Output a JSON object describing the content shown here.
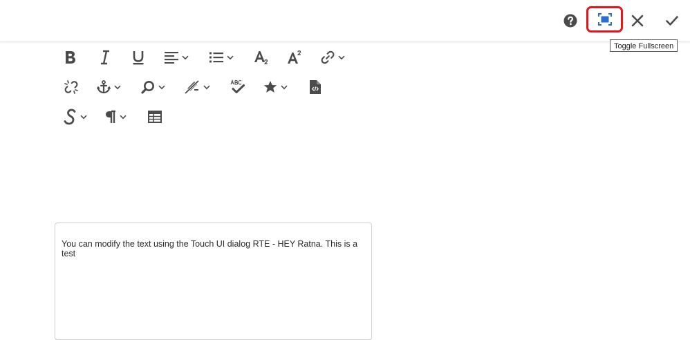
{
  "topbar": {
    "help_icon": "help-circle-icon",
    "fullscreen_icon": "fullscreen-icon",
    "close_icon": "close-icon",
    "done_icon": "checkmark-icon",
    "fullscreen_highlight_color": "#e8141c",
    "fullscreen_icon_color": "#2b6ed2",
    "icon_color": "#4b4b4b"
  },
  "tooltip": {
    "text": "Toggle Fullscreen"
  },
  "toolbar": {
    "rows": [
      [
        "bold-icon",
        "italic-icon",
        "underline-icon",
        "align-icon",
        "list-icon",
        "subscript-icon",
        "superscript-icon",
        "link-icon"
      ],
      [
        "unlink-icon",
        "anchor-icon",
        "find-icon",
        "edit-icon",
        "spellcheck-icon",
        "special-chars-icon",
        "source-edit-icon"
      ],
      [
        "styles-icon",
        "paragraph-format-icon",
        "table-icon"
      ]
    ]
  },
  "editor": {
    "text": "You can modify the text using the Touch UI dialog RTE - HEY Ratna. This is a test"
  }
}
